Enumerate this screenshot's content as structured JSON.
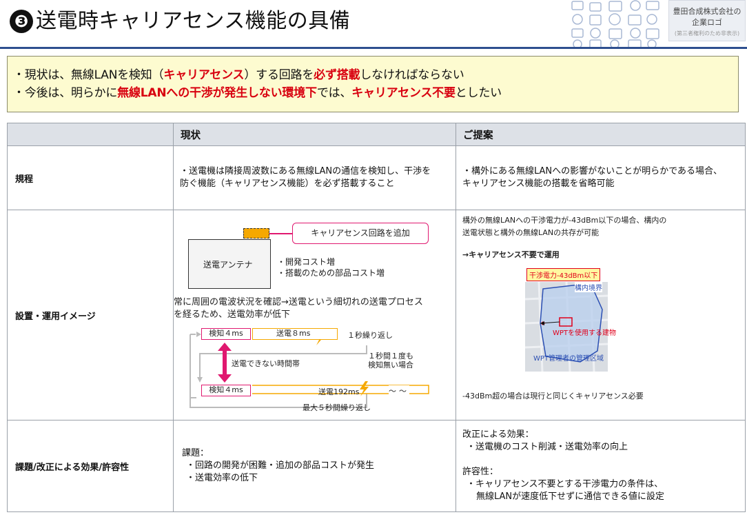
{
  "header": {
    "number": "❸",
    "title": "送電時キャリアセンス機能の具備",
    "logo_line1": "豊田合成株式会社の",
    "logo_line2": "企業ロゴ",
    "logo_note": "(第三者権利のため非表示)"
  },
  "summary": {
    "line1_a": "・現状は、無線LANを検知（",
    "line1_b": "キャリアセンス",
    "line1_c": "）する回路を",
    "line1_d": "必ず搭載",
    "line1_e": "しなければならない",
    "line2_a": "・今後は、明らかに",
    "line2_b": "無線LANへの干渉が発生しない環境下",
    "line2_c": "では、",
    "line2_d": "キャリアセンス不要",
    "line2_e": "としたい"
  },
  "table": {
    "col_current": "現状",
    "col_proposal": "ご提案",
    "rows": {
      "regulation": {
        "label": "規程",
        "current_1": "・送電機は隣接周波数にある無線LANの通信を検知し、干渉を",
        "current_2": "防ぐ機能（キャリアセンス機能）を必ず搭載すること",
        "proposal_1": "・構外にある無線LANへの影響がないことが明らかである場合、",
        "proposal_2": "キャリアセンス機能の搭載を省略可能"
      },
      "install": {
        "label": "設置・運用イメージ",
        "diagram": {
          "add_circuit": "キャリアセンス回路を追加",
          "antenna": "送電アンテナ",
          "cost1": "・開発コスト増",
          "cost2": "・搭載のための部品コスト増",
          "desc1": "常に周囲の電波状況を確認→送電という細切れの送電プロセス",
          "desc2": "を経るため、送電効率が低下",
          "detect1": "検知４ms",
          "send1": "送電８ms",
          "repeat1": "１秒繰り返し",
          "no_send": "送電できない時間帯",
          "no_detect1": "１秒間１度も",
          "no_detect2": "検知無い場合",
          "detect2": "検知４ms",
          "send2": "送電192ms",
          "tilde": "〜〜",
          "repeat2": "最大５秒間繰り返し"
        },
        "proposal_1": "構外の無線LANへの干渉電力が-43dBm以下の場合、構内の",
        "proposal_2": "送電状態と構外の無線LANの共存が可能",
        "proposal_arrow": "→キャリアセンス不要で運用",
        "map_label": "干渉電力-43dBm以下",
        "map_boundary": "構内境界",
        "map_building": "WPTを使用する建物",
        "map_area": "WPT管理者の管理区域",
        "proposal_bottom": "-43dBm超の場合は現行と同じくキャリアセンス必要"
      },
      "issues": {
        "label": "課題/改正による効果/許容性",
        "current_1": "課題：",
        "current_2": "・回路の開発が困難・追加の部品コストが発生",
        "current_3": "・送電効率の低下",
        "effect_1": "改正による効果：",
        "effect_2": "・送電機のコスト削減・送電効率の向上",
        "allow_1": "許容性：",
        "allow_2": "・キャリアセンス不要とする干渉電力の条件は、",
        "allow_3": "無線LANが速度低下せずに通信できる値に設定"
      }
    }
  },
  "colors": {
    "accent_red": "#d8000f",
    "header_rule": "#2e4f8f",
    "summary_bg": "#fdfbd0",
    "pink": "#e0186f",
    "orange": "#f5a800"
  }
}
